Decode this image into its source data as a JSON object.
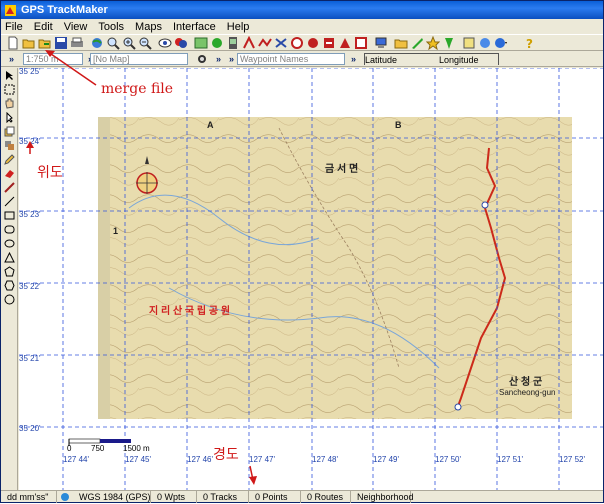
{
  "window": {
    "title": "GPS TrackMaker"
  },
  "menu": [
    "File",
    "Edit",
    "View",
    "Tools",
    "Maps",
    "Interface",
    "Help"
  ],
  "toolbar2": {
    "scale_value": "1:750 m",
    "map_value": "[No Map]",
    "waypoint_placeholder": "Waypoint Names",
    "latitude_label": "Latitude",
    "longitude_label": "Longitude"
  },
  "annotations": {
    "merge_file": "merge file",
    "latitude_ko": "위도",
    "longitude_ko": "경도"
  },
  "latitudes": [
    "35 25'",
    "35 24'",
    "35 23'",
    "35 22'",
    "35 21'",
    "35 20'"
  ],
  "longitudes": [
    "127 44'",
    "127 45'",
    "127 46'",
    "127 47'",
    "127 48'",
    "127 49'",
    "127 50'",
    "127 51'",
    "127 52'"
  ],
  "map_labels": {
    "grid_a": "A",
    "grid_b": "B",
    "grid_row_1": "1",
    "region_name": "금 서 면",
    "park_name": "지 리 산 국 립 공 원",
    "county_name": "산 청 군",
    "county_roman": "Sancheong-gun"
  },
  "scalebar": {
    "ticks": [
      "0",
      "750",
      "1500 m"
    ]
  },
  "status": {
    "format": "dd mm'ss\"",
    "datum": "WGS 1984 (GPS)",
    "waypoints": "0 Wpts",
    "tracks": "0 Tracks",
    "points": "0 Points",
    "routes": "0 Routes",
    "neighborhood": "Neighborhood"
  },
  "colors": {
    "track": "#cc2a1a",
    "grid": "#3355dd",
    "annotation": "#d01818"
  }
}
